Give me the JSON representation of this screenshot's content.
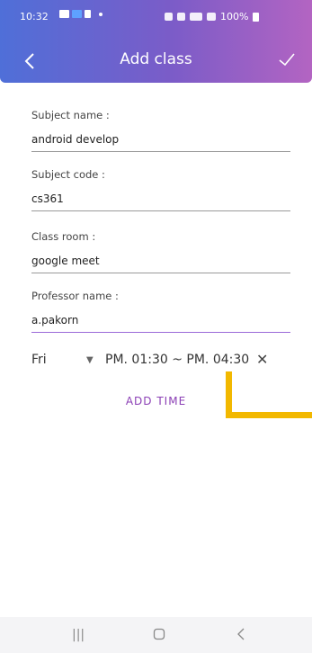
{
  "status_bar": {
    "time": "10:32",
    "battery": "100%"
  },
  "toolbar": {
    "title": "Add class",
    "back_icon": "chevron-left-icon",
    "confirm_icon": "check-icon"
  },
  "form": {
    "subject_name": {
      "label": "Subject name :",
      "value": "android develop"
    },
    "subject_code": {
      "label": "Subject code :",
      "value": "cs361"
    },
    "class_room": {
      "label": "Class room :",
      "value": "google meet"
    },
    "professor_name": {
      "label": "Professor name :",
      "value": "a.pakorn"
    }
  },
  "schedule": {
    "day": "Fri",
    "time_range": "PM. 01:30 ~ PM. 04:30",
    "add_time_label": "ADD TIME"
  },
  "colors": {
    "accent": "#8b3fb5",
    "highlight": "#f2b800"
  }
}
